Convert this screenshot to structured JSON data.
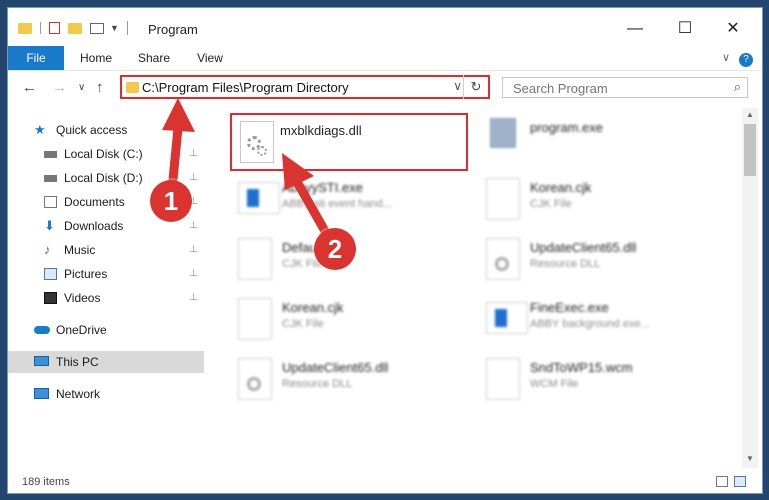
{
  "window": {
    "title": "Program",
    "minimize": "—",
    "maximize": "☐",
    "close": "✕",
    "help": "?"
  },
  "ribbon": {
    "tabs": [
      "File",
      "Home",
      "Share",
      "View"
    ],
    "expand": "∨"
  },
  "nav": {
    "back": "←",
    "forward": "→",
    "recent": "∨",
    "up": "↑",
    "address": "C:\\Program Files\\Program Directory",
    "address_dropdown": "∨",
    "refresh": "↻",
    "search_placeholder": "Search Program",
    "search_icon": "⌕"
  },
  "sidebar": {
    "items": [
      {
        "label": "Quick access",
        "icon": "star-icon"
      },
      {
        "label": "Local Disk (C:)",
        "icon": "drive-icon",
        "pinned": true
      },
      {
        "label": "Local Disk (D:)",
        "icon": "drive-icon",
        "pinned": true
      },
      {
        "label": "Documents",
        "icon": "documents-icon",
        "pinned": true
      },
      {
        "label": "Downloads",
        "icon": "downloads-icon",
        "pinned": true
      },
      {
        "label": "Music",
        "icon": "music-icon",
        "pinned": true
      },
      {
        "label": "Pictures",
        "icon": "pictures-icon",
        "pinned": true
      },
      {
        "label": "Videos",
        "icon": "videos-icon",
        "pinned": true
      },
      {
        "label": "OneDrive",
        "icon": "onedrive-icon"
      },
      {
        "label": "This PC",
        "icon": "computer-icon",
        "selected": true
      },
      {
        "label": "Network",
        "icon": "network-icon"
      }
    ],
    "pin_glyph": "📌"
  },
  "files": {
    "highlighted": {
      "name": "mxblkdiags.dll"
    },
    "items": [
      {
        "name": "program.exe",
        "type": "",
        "col": 1
      },
      {
        "name": "AbbyySTI.exe",
        "type": "ABBY sti event hand...",
        "col": 0
      },
      {
        "name": "Korean.cjk",
        "type": "CJK File",
        "col": 1
      },
      {
        "name": "Default.cjk",
        "type": "CJK File",
        "col": 0
      },
      {
        "name": "UpdateClient65.dll",
        "type": "Resource DLL",
        "col": 1
      },
      {
        "name": "Korean.cjk",
        "type": "CJK File",
        "col": 0
      },
      {
        "name": "FineExec.exe",
        "type": "ABBY background exe...",
        "col": 1
      },
      {
        "name": "UpdateClient65.dll",
        "type": "Resource DLL",
        "col": 0
      },
      {
        "name": "SndToWP15.wcm",
        "type": "WCM File",
        "col": 1
      }
    ]
  },
  "status": {
    "item_count": "189 items"
  },
  "annotations": {
    "step1": "1",
    "step2": "2"
  },
  "colors": {
    "accent": "#1979ca",
    "highlight": "#e02b2b",
    "badge": "#d93430",
    "background": "#22466e"
  }
}
